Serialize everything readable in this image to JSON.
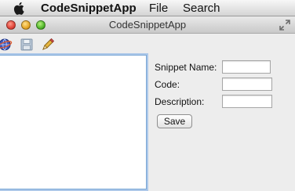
{
  "menubar": {
    "apple_icon": "apple-logo-icon",
    "items": [
      {
        "label": "CodeSnippetApp"
      },
      {
        "label": "File"
      },
      {
        "label": "Search"
      }
    ]
  },
  "window": {
    "title": "CodeSnippetApp",
    "controls": [
      "close-icon",
      "minimize-icon",
      "zoom-icon"
    ],
    "fullscreen_icon": "fullscreen-arrows-icon"
  },
  "toolbar": {
    "buttons": [
      {
        "icon": "globe-icon"
      },
      {
        "icon": "floppy-disk-icon"
      },
      {
        "icon": "pen-icon"
      }
    ]
  },
  "form": {
    "snippet_name_label": "Snippet Name:",
    "snippet_name_value": "",
    "code_label": "Code:",
    "code_value": "",
    "description_label": "Description:",
    "description_value": "",
    "save_label": "Save"
  },
  "colors": {
    "accent_focus": "#7aa7d6",
    "close": "#e0443a",
    "minimize": "#e6a626",
    "zoom": "#52b82c"
  }
}
